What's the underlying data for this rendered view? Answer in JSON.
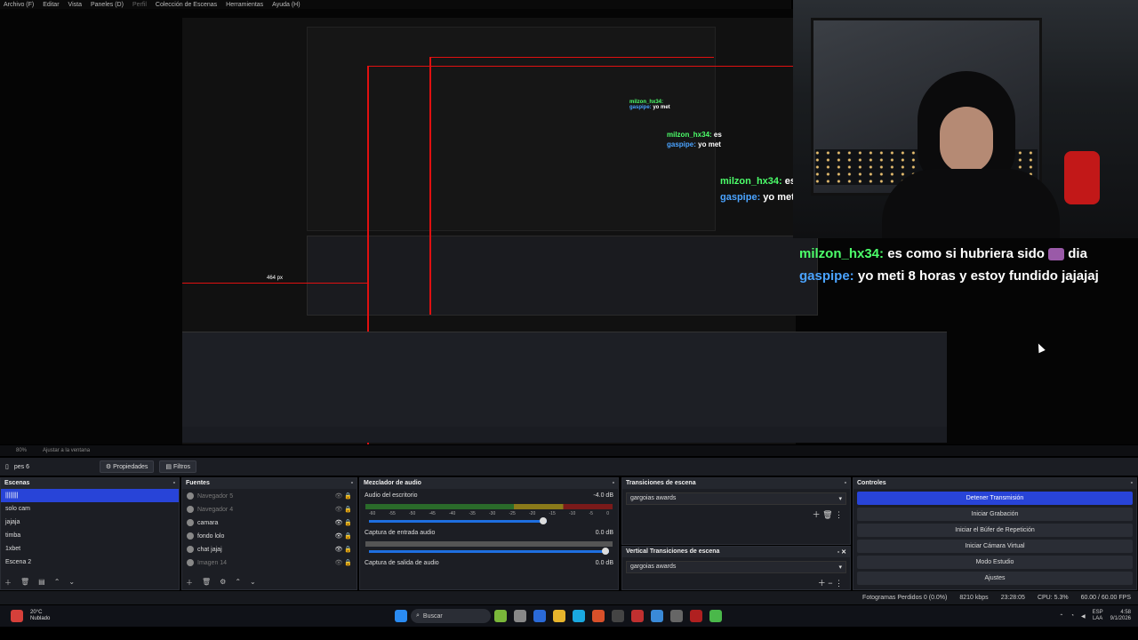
{
  "menu": [
    "Archivo (F)",
    "Editar",
    "Vista",
    "Paneles (D)",
    "Perfil",
    "Colección de Escenas",
    "Herramientas",
    "Ayuda (H)"
  ],
  "chat": {
    "user1": "milzon_hx34:",
    "msg1": "es como si hubriera sido",
    "msg1_end": "dia",
    "user2": "gaspipe:",
    "msg2": "yo meti 8 horas y estoy fundido jajajaj",
    "small1": "es",
    "small2": "yo met",
    "tiny2": "yo meti"
  },
  "measure": {
    "px": "464 px"
  },
  "status": {
    "zoom": "80%",
    "fit": "Ajustar a la ventana"
  },
  "scene_bar": {
    "scene": "pes 6",
    "props": "Propiedades",
    "filters": "Filtros"
  },
  "scenes": {
    "title": "Escenas",
    "items": [
      "||||||||",
      "solo cam",
      "jajaja",
      "timba",
      "1xbet",
      "Escena 2"
    ]
  },
  "sources": {
    "title": "Fuentes",
    "items": [
      "Navegador 5",
      "Navegador 4",
      "camara",
      "fondo lolo",
      "chat jajaj",
      "Imagen 14"
    ]
  },
  "mixer": {
    "title": "Mezclador de audio",
    "ch1": "Audio del escritorio",
    "ch1_db": "-4.0 dB",
    "ch2": "Captura de entrada audio",
    "ch2_db": "0.0 dB",
    "ch3": "Captura de salida de audio",
    "ch3_db": "0.0 dB",
    "scale": [
      "-60",
      "-55",
      "-50",
      "-45",
      "-40",
      "-35",
      "-30",
      "-25",
      "-20",
      "-15",
      "-10",
      "-5",
      "0"
    ]
  },
  "transitions": {
    "title": "Transiciones de escena",
    "value": "gargoias awards",
    "vtitle": "Vertical Transiciones de escena",
    "vvalue": "gargoias awards"
  },
  "controls": {
    "title": "Controles",
    "buttons": [
      "Detener Transmisión",
      "Iniciar Grabación",
      "Iniciar el Búfer de Repetición",
      "Iniciar Cámara Virtual",
      "Modo Estudio",
      "Ajustes"
    ]
  },
  "stats": {
    "dropped": "Fotogramas Perdidos 0 (0.0%)",
    "kbps": "8210 kbps",
    "time": "23:28:05",
    "cpu": "CPU: 5.3%",
    "fps": "60.00 / 60.00 FPS"
  },
  "taskbar": {
    "weather_temp": "20°C",
    "weather_desc": "Nublado",
    "search": "Buscar",
    "lang": "ESP",
    "lang2": "LAA",
    "clock": "4:58",
    "date": "9/1/2026"
  }
}
